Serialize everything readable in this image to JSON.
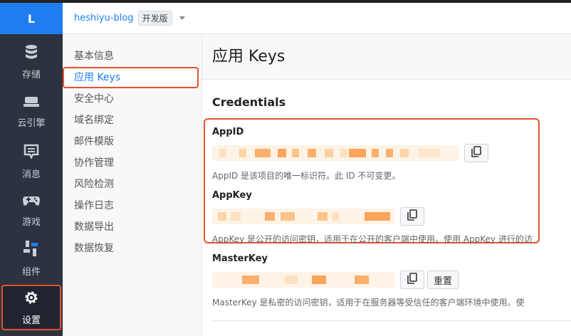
{
  "rail": {
    "logo": "L",
    "items": [
      {
        "label": "存储",
        "icon": "database-icon"
      },
      {
        "label": "云引擎",
        "icon": "engine-icon"
      },
      {
        "label": "消息",
        "icon": "message-icon"
      },
      {
        "label": "游戏",
        "icon": "gamepad-icon"
      },
      {
        "label": "组件",
        "icon": "components-icon"
      },
      {
        "label": "设置",
        "icon": "gear-icon",
        "active": true
      }
    ]
  },
  "header": {
    "app_name": "heshiyu-blog",
    "edition": "开发版"
  },
  "subnav": {
    "items": [
      "基本信息",
      "应用 Keys",
      "安全中心",
      "域名绑定",
      "邮件模版",
      "协作管理",
      "风险检测",
      "操作日志",
      "数据导出",
      "数据恢复"
    ],
    "active_index": 1
  },
  "main": {
    "title": "应用 Keys",
    "section": "Credentials",
    "appid": {
      "label": "AppID",
      "help": "AppID 是该项目的唯一标识符。此 ID 不可变更。"
    },
    "appkey": {
      "label": "AppKey",
      "help": "AppKey 是公开的访问密钥，适用于在公开的客户端中使用。使用 AppKey 进行的访"
    },
    "masterkey": {
      "label": "MasterKey",
      "reset_label": "重置",
      "help": "MasterKey 是私密的访问密钥，适用于在服务器等受信任的客户端环境中使用。使"
    }
  },
  "colors": {
    "accent": "#1e7ef0",
    "highlight_border": "#e2532f",
    "rail_bg": "#2d3240"
  }
}
